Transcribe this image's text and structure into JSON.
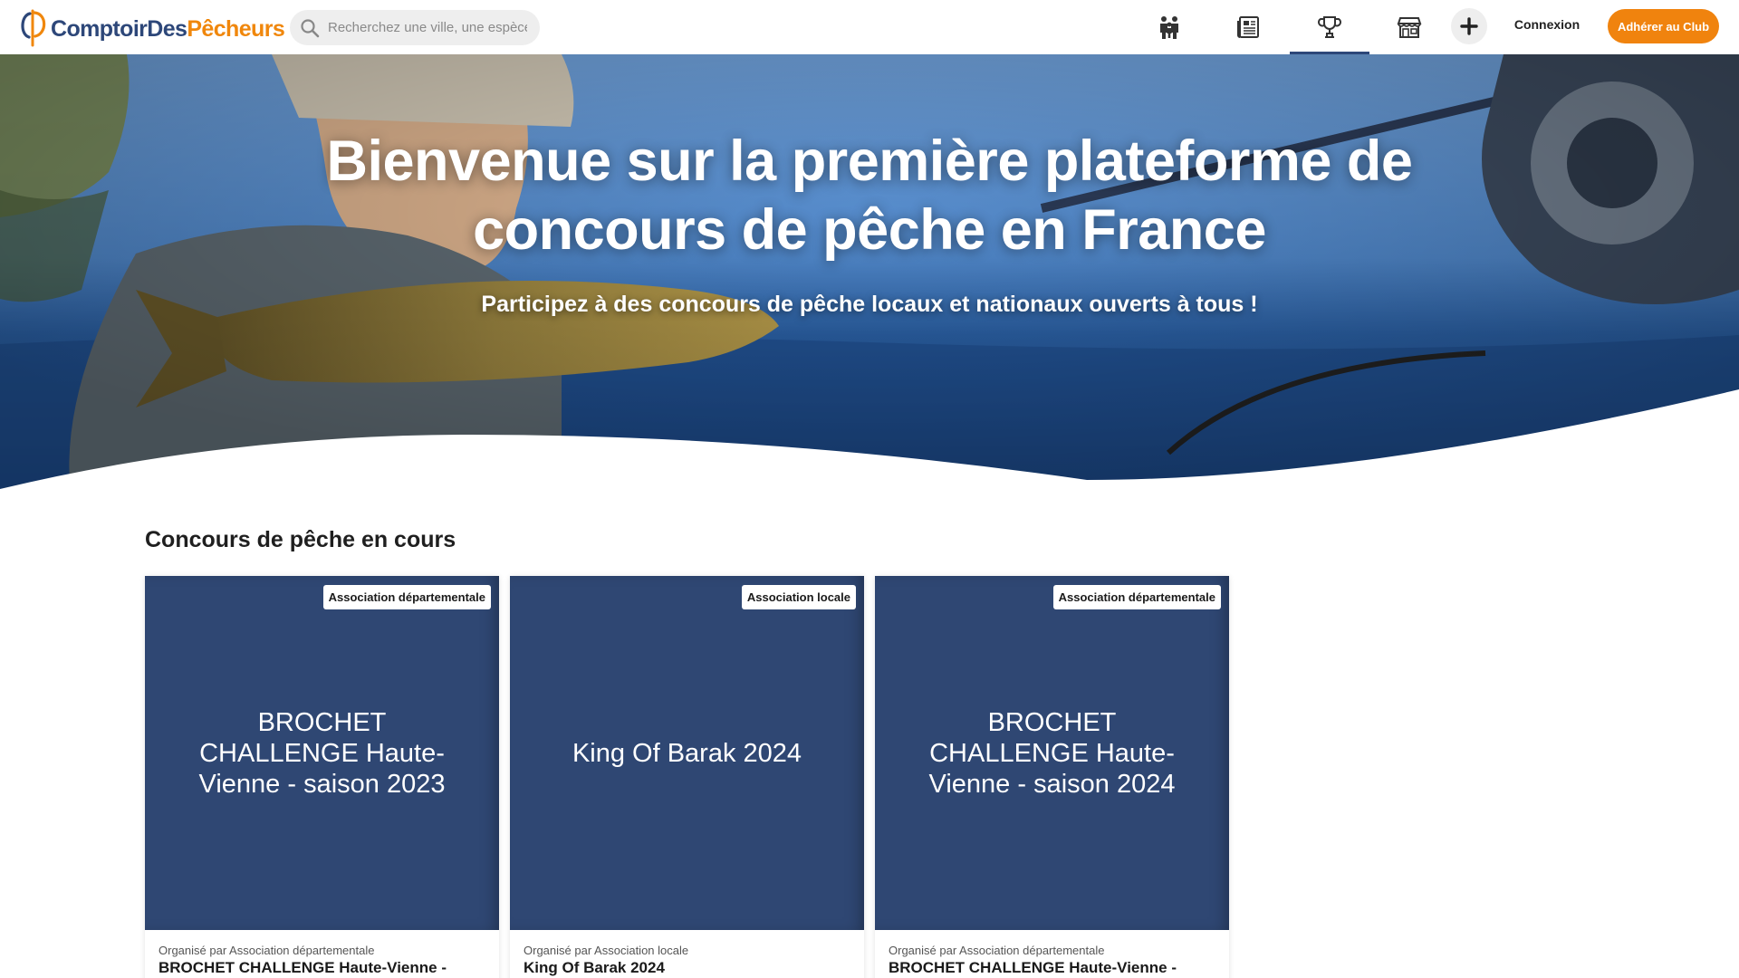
{
  "brand": {
    "name_part1": "ComptoirDes",
    "name_part2": "Pêcheurs",
    "primary_color": "#2d4779",
    "accent_color": "#f0870c"
  },
  "search": {
    "placeholder": "Recherchez une ville, une espèce.."
  },
  "nav": {
    "items": [
      {
        "icon": "community-icon",
        "active": false
      },
      {
        "icon": "news-icon",
        "active": false
      },
      {
        "icon": "trophy-icon",
        "active": true
      },
      {
        "icon": "shop-icon",
        "active": false
      }
    ],
    "plus_icon": "plus-icon",
    "login_label": "Connexion",
    "join_label": "Adhérer au Club"
  },
  "hero": {
    "title_line1": "Bienvenue sur la première plateforme de",
    "title_line2": "concours de pêche en France",
    "subtitle": "Participez à des concours de pêche locaux et nationaux ouverts à tous !"
  },
  "section": {
    "title": "Concours de pêche en cours"
  },
  "cards": [
    {
      "badge": "Association départementale",
      "cover_title": "BROCHET CHALLENGE Haute-Vienne - saison 2023",
      "organizer": "Organisé par Association départementale",
      "name": "BROCHET CHALLENGE Haute-Vienne -"
    },
    {
      "badge": "Association locale",
      "cover_title": "King Of Barak 2024",
      "organizer": "Organisé par Association locale",
      "name": "King Of Barak 2024"
    },
    {
      "badge": "Association départementale",
      "cover_title": "BROCHET CHALLENGE Haute-Vienne - saison 2024",
      "organizer": "Organisé par Association départementale",
      "name": "BROCHET CHALLENGE Haute-Vienne -"
    }
  ]
}
